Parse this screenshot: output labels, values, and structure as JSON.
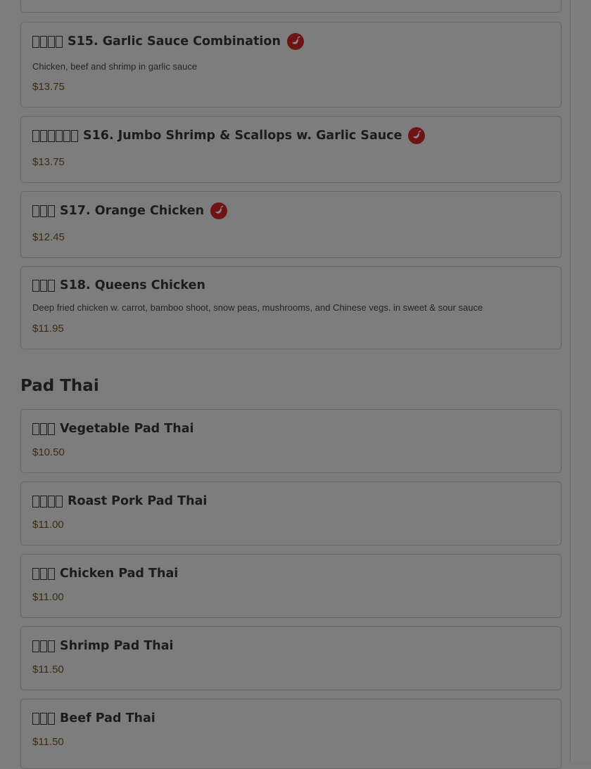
{
  "menu": {
    "spicy_items": [
      {
        "title": "S15. Garlic Sauce Combination",
        "desc": "Chicken, beef and shrimp in garlic sauce",
        "price": "$13.75"
      },
      {
        "title": "S16. Jumbo Shrimp & Scallops w. Garlic Sauce",
        "desc": "",
        "price": "$13.75"
      },
      {
        "title": "S17. Orange Chicken",
        "desc": "",
        "price": "$12.45"
      },
      {
        "title": "S18. Queens Chicken",
        "desc": "Deep fried chicken w. carrot, bamboo shoot, snow peas, mushrooms, and Chinese vegs. in sweet & sour sauce",
        "price": "$11.95"
      }
    ],
    "pad_thai": {
      "heading": "Pad Thai",
      "items": [
        {
          "title": "Vegetable Pad Thai",
          "price": "$10.50"
        },
        {
          "title": "Roast Pork Pad Thai",
          "price": "$11.00"
        },
        {
          "title": "Chicken Pad Thai",
          "price": "$11.00"
        },
        {
          "title": "Shrimp Pad Thai",
          "price": "$11.50"
        },
        {
          "title": "Beef Pad Thai",
          "price": "$11.50"
        }
      ]
    }
  },
  "icons": {
    "spicy": "chili-pepper-icon",
    "missing_glyph": "missing-glyph-box"
  },
  "colors": {
    "overlay_background": "#7c7c7c",
    "price": "#3e2a0f",
    "spicy_badge": "#6e1414"
  }
}
